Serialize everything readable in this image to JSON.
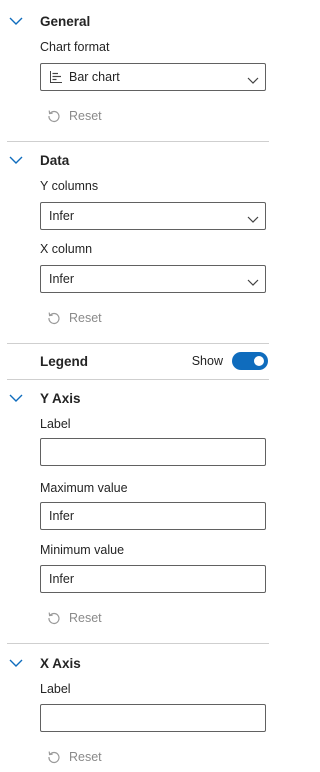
{
  "general": {
    "title": "General",
    "chart_format_label": "Chart format",
    "chart_format_value": "Bar chart",
    "reset_label": "Reset"
  },
  "data_section": {
    "title": "Data",
    "y_columns_label": "Y columns",
    "y_columns_value": "Infer",
    "x_column_label": "X column",
    "x_column_value": "Infer",
    "reset_label": "Reset"
  },
  "legend": {
    "title": "Legend",
    "toggle_label": "Show",
    "enabled": true
  },
  "y_axis": {
    "title": "Y Axis",
    "label_label": "Label",
    "label_value": "",
    "max_label": "Maximum value",
    "max_placeholder": "Infer",
    "min_label": "Minimum value",
    "min_placeholder": "Infer",
    "reset_label": "Reset"
  },
  "x_axis": {
    "title": "X Axis",
    "label_label": "Label",
    "label_value": "",
    "reset_label": "Reset"
  },
  "colors": {
    "accent": "#0f6cbd",
    "text": "#242424",
    "muted": "#8a8a8a",
    "border": "#616161",
    "divider": "#cfcfcf"
  }
}
